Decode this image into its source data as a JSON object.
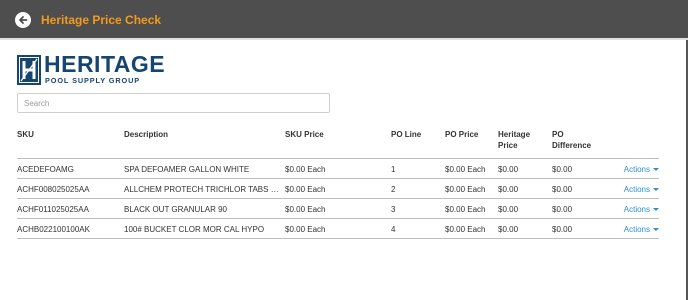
{
  "header": {
    "title": "Heritage Price Check",
    "back_icon": "back-arrow-circle-icon",
    "background": "#4e4e4e",
    "title_color": "#f39a1e"
  },
  "logo": {
    "word": "HERITAGE",
    "sub": "POOL SUPPLY GROUP",
    "color": "#16456f"
  },
  "search": {
    "placeholder": "Search",
    "value": ""
  },
  "table": {
    "headers": {
      "sku": "SKU",
      "description": "Description",
      "sku_price": "SKU Price",
      "po_line": "PO Line",
      "po_price": "PO Price",
      "heritage_price_1": "Heritage",
      "heritage_price_2": "Price",
      "po_difference_1": "PO",
      "po_difference_2": "Difference"
    },
    "rows": [
      {
        "sku": "ACEDEFOAMG",
        "description": "SPA DEFOAMER GALLON WHITE",
        "sku_price": "$0.00 Each",
        "po_line": "1",
        "po_price": "$0.00 Each",
        "heritage_price": "$0.00",
        "po_difference": "$0.00",
        "actions": "Actions"
      },
      {
        "sku": "ACHF008025025AA",
        "description": "ALLCHEM PROTECH TRICHLOR TABS UN...",
        "sku_price": "$0.00 Each",
        "po_line": "2",
        "po_price": "$0.00 Each",
        "heritage_price": "$0.00",
        "po_difference": "$0.00",
        "actions": "Actions"
      },
      {
        "sku": "ACHF011025025AA",
        "description": "BLACK OUT GRANULAR 90",
        "sku_price": "$0.00 Each",
        "po_line": "3",
        "po_price": "$0.00 Each",
        "heritage_price": "$0.00",
        "po_difference": "$0.00",
        "actions": "Actions"
      },
      {
        "sku": "ACHB022100100AK",
        "description": "100# BUCKET CLOR MOR CAL HYPO",
        "sku_price": "$0.00 Each",
        "po_line": "4",
        "po_price": "$0.00 Each",
        "heritage_price": "$0.00",
        "po_difference": "$0.00",
        "actions": "Actions"
      }
    ],
    "link_color": "#2a8fd6"
  }
}
